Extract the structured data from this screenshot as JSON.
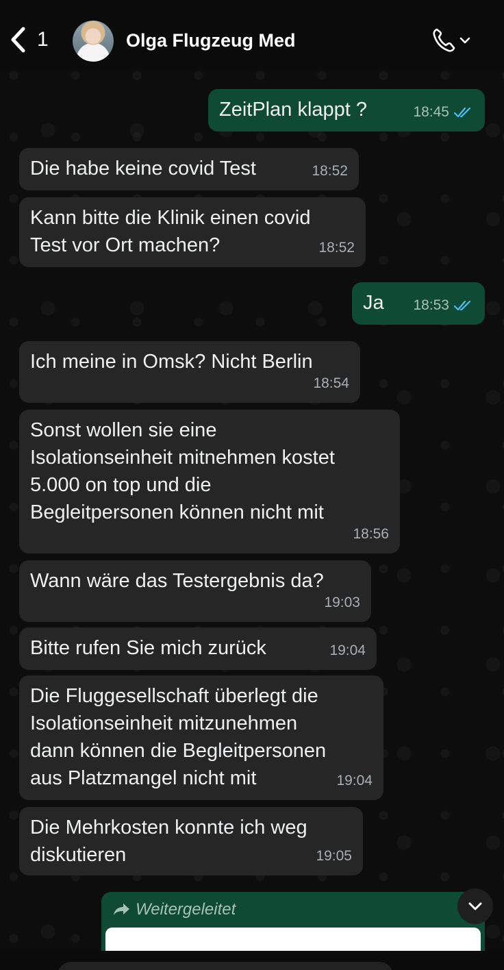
{
  "header": {
    "back_count": "1",
    "contact_name": "Olga Flugzeug Med",
    "call_icon": "phone-icon"
  },
  "messages": [
    {
      "text": "ZeitPlan klappt ?",
      "time": "18:45",
      "direction": "out",
      "read": true
    },
    {
      "text": "Die habe keine covid Test",
      "time": "18:52",
      "direction": "in"
    },
    {
      "text": "Kann bitte die Klinik einen covid\nTest vor Ort machen?",
      "time": "18:52",
      "direction": "in"
    },
    {
      "text": "Ja",
      "time": "18:53",
      "direction": "out",
      "read": true
    },
    {
      "text": "Ich meine in Omsk? Nicht Berlin",
      "time": "18:54",
      "direction": "in"
    },
    {
      "text": "Sonst wollen sie eine\nIsolationseinheit mitnehmen kostet\n5.000 on top und die\nBegleitpersonen können nicht mit",
      "time": "18:56",
      "direction": "in"
    },
    {
      "text": "Wann wäre das Testergebnis da?",
      "time": "19:03",
      "direction": "in"
    },
    {
      "text": "Bitte rufen Sie mich zurück",
      "time": "19:04",
      "direction": "in"
    },
    {
      "text": "Die Fluggesellschaft überlegt die\nIsolationseinheit mitzunehmen\ndann können die Begleitpersonen\naus Platzmangel nicht mit",
      "time": "19:04",
      "direction": "in"
    },
    {
      "text": "Die Mehrkosten konnte ich weg\ndiskutieren",
      "time": "19:05",
      "direction": "in"
    }
  ],
  "forwarded": {
    "label": "Weitergeleitet"
  },
  "colors": {
    "outgoing_bubble": "#0f4a34",
    "incoming_bubble": "#262626",
    "read_ticks": "#53bdeb"
  }
}
